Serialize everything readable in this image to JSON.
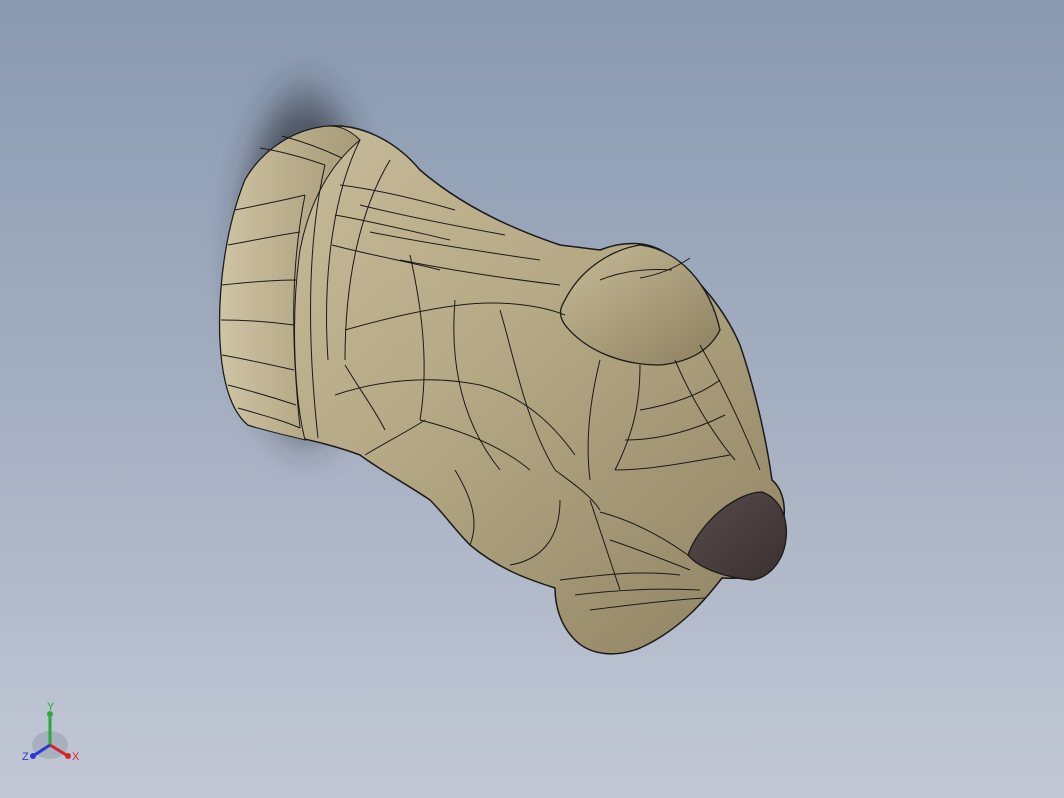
{
  "viewport": {
    "background_top": "#8a9ab0",
    "background_bottom": "#c2c8d5"
  },
  "model": {
    "face_color": "#b3a684",
    "edge_color": "#1a1a1a",
    "cap_color": "#4a3f3f",
    "shadow_color": "#2a2f3a"
  },
  "triad": {
    "x_label": "X",
    "y_label": "Y",
    "z_label": "Z",
    "x_color": "#d8222a",
    "y_color": "#2aa838",
    "z_color": "#2a3ad8"
  }
}
